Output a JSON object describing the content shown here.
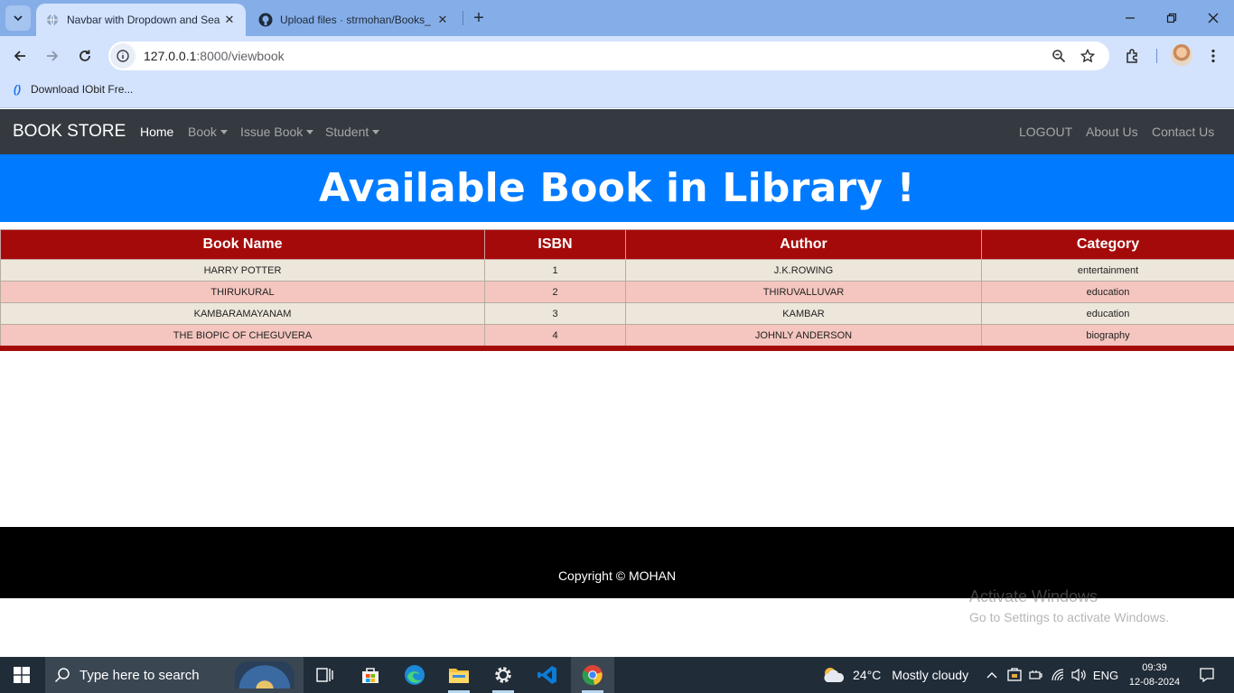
{
  "browser": {
    "tabs": [
      {
        "title": "Navbar with Dropdown and Sea",
        "active": true
      },
      {
        "title": "Upload files · strmohan/Books_",
        "active": false
      }
    ],
    "url_host": "127.0.0.1",
    "url_rest": ":8000/viewbook",
    "bookmark": "Download IObit Fre..."
  },
  "navbar": {
    "brand": "BOOK STORE",
    "links_left": [
      "Home",
      "Book",
      "Issue Book",
      "Student"
    ],
    "links_right": [
      "LOGOUT",
      "About Us",
      "Contact Us"
    ]
  },
  "banner": {
    "title": "Available Book in Library !"
  },
  "table": {
    "headers": [
      "Book Name",
      "ISBN",
      "Author",
      "Category"
    ],
    "rows": [
      [
        "HARRY POTTER",
        "1",
        "J.K.ROWING",
        "entertainment"
      ],
      [
        "THIRUKURAL",
        "2",
        "THIRUVALLUVAR",
        "education"
      ],
      [
        "KAMBARAMAYANAM",
        "3",
        "KAMBAR",
        "education"
      ],
      [
        "THE BIOPIC OF CHEGUVERA",
        "4",
        "JOHNLY ANDERSON",
        "biography"
      ]
    ]
  },
  "footer": {
    "text": "Copyright © MOHAN"
  },
  "watermark": {
    "line1": "Activate Windows",
    "line2": "Go to Settings to activate Windows."
  },
  "taskbar": {
    "search_placeholder": "Type here to search",
    "temperature": "24°C",
    "weather": "Mostly cloudy",
    "language": "ENG",
    "time": "09:39",
    "date": "12-08-2024"
  },
  "colors": {
    "navbar_bg": "#343a40",
    "banner_bg": "#007bff",
    "table_header_bg": "#a50a0a",
    "row_odd_bg": "#ede6db",
    "row_even_bg": "#f4c6bf",
    "footer_bg": "#000000"
  }
}
